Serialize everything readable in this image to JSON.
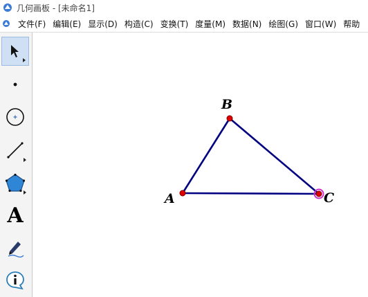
{
  "window": {
    "title": "几何画板 - [未命名1]"
  },
  "menu": [
    {
      "label": "文件(F)"
    },
    {
      "label": "编辑(E)"
    },
    {
      "label": "显示(D)"
    },
    {
      "label": "构造(C)"
    },
    {
      "label": "变换(T)"
    },
    {
      "label": "度量(M)"
    },
    {
      "label": "数据(N)"
    },
    {
      "label": "绘图(G)"
    },
    {
      "label": "窗口(W)"
    },
    {
      "label": "帮助"
    }
  ],
  "toolbox": {
    "tools": [
      {
        "name": "arrow-tool",
        "icon": "arrow-icon",
        "selected": true
      },
      {
        "name": "point-tool",
        "icon": "point-icon"
      },
      {
        "name": "compass-tool",
        "icon": "circle-icon"
      },
      {
        "name": "straightedge-tool",
        "icon": "segment-icon"
      },
      {
        "name": "polygon-tool",
        "icon": "polygon-icon"
      },
      {
        "name": "text-tool",
        "icon": "text-icon",
        "glyph": "A"
      },
      {
        "name": "marker-tool",
        "icon": "marker-icon"
      },
      {
        "name": "information-tool",
        "icon": "info-icon"
      }
    ]
  },
  "figure": {
    "points": [
      {
        "label": "A"
      },
      {
        "label": "B"
      },
      {
        "label": "C",
        "selected": true
      }
    ],
    "colors": {
      "segment": "#000080",
      "point": "#e00000",
      "selection": "#cc33cc"
    }
  }
}
